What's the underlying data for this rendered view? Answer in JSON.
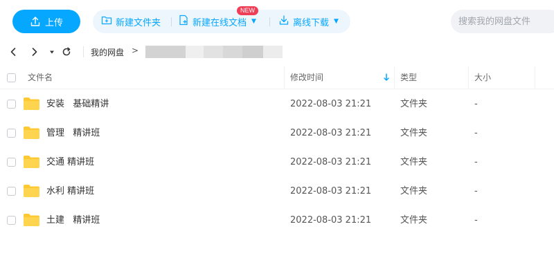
{
  "toolbar": {
    "upload_label": "上传",
    "new_folder_label": "新建文件夹",
    "new_online_doc_label": "新建在线文档",
    "new_badge": "NEW",
    "offline_download_label": "离线下载",
    "search_placeholder": "搜索我的网盘文件"
  },
  "nav": {
    "breadcrumb_root": "我的网盘",
    "breadcrumb_separator": ">"
  },
  "table": {
    "headers": {
      "name": "文件名",
      "modified": "修改时间",
      "type": "类型",
      "size": "大小"
    },
    "rows": [
      {
        "name": "安装   基础精讲",
        "modified": "2022-08-03 21:21",
        "type": "文件夹",
        "size": "-"
      },
      {
        "name": "管理   精讲班",
        "modified": "2022-08-03 21:21",
        "type": "文件夹",
        "size": "-"
      },
      {
        "name": "交通 精讲班",
        "modified": "2022-08-03 21:21",
        "type": "文件夹",
        "size": "-"
      },
      {
        "name": "水利 精讲班",
        "modified": "2022-08-03 21:21",
        "type": "文件夹",
        "size": "-"
      },
      {
        "name": "土建   精讲班",
        "modified": "2022-08-03 21:21",
        "type": "文件夹",
        "size": "-"
      }
    ]
  },
  "colors": {
    "accent": "#06a7ff",
    "folder": "#ffc933",
    "badge": "#f03e57"
  },
  "icons": [
    "upload-icon",
    "new-folder-icon",
    "new-doc-icon",
    "download-icon",
    "back-icon",
    "forward-icon",
    "dropdown-icon",
    "refresh-icon",
    "sort-down-icon",
    "folder-icon"
  ]
}
